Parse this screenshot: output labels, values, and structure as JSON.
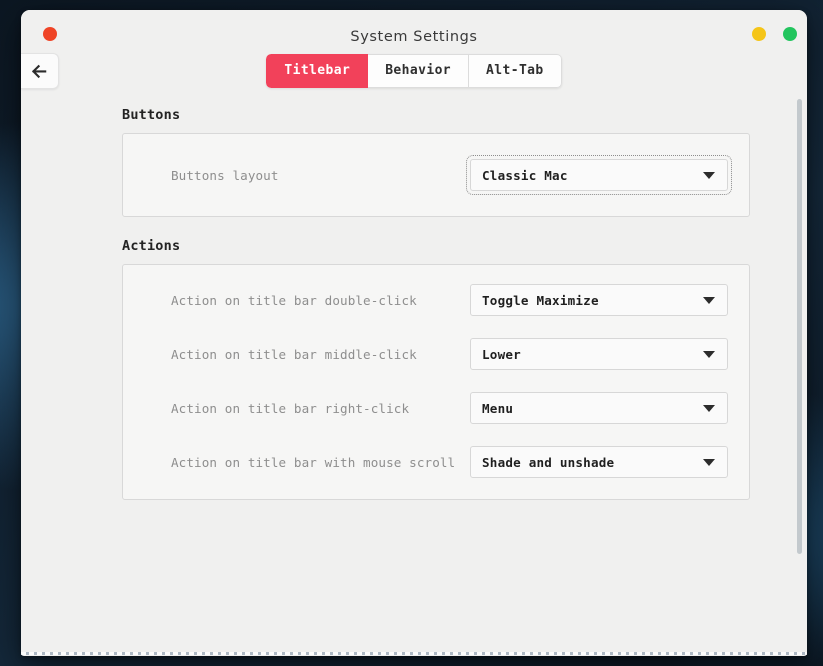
{
  "window": {
    "title": "System Settings",
    "controls": {
      "close": {
        "name": "close-window-button",
        "color": "#ef4426"
      },
      "minimize": {
        "name": "minimize-window-button",
        "color": "#f5c518"
      },
      "maximize": {
        "name": "maximize-window-button",
        "color": "#22c55e"
      }
    },
    "back_button_icon": "arrow-left-icon"
  },
  "accent_color": "#f2415a",
  "tabs": [
    {
      "label": "Titlebar",
      "active": true
    },
    {
      "label": "Behavior",
      "active": false
    },
    {
      "label": "Alt-Tab",
      "active": false
    }
  ],
  "sections": [
    {
      "heading": "Buttons",
      "rows": [
        {
          "label": "Buttons layout",
          "value": "Classic Mac",
          "focused": true
        }
      ]
    },
    {
      "heading": "Actions",
      "rows": [
        {
          "label": "Action on title bar double-click",
          "value": "Toggle Maximize",
          "focused": false
        },
        {
          "label": "Action on title bar middle-click",
          "value": "Lower",
          "focused": false
        },
        {
          "label": "Action on title bar right-click",
          "value": "Menu",
          "focused": false
        },
        {
          "label": "Action on title bar with mouse scroll",
          "value": "Shade and unshade",
          "focused": false
        }
      ]
    }
  ],
  "scrollbar": {
    "name": "vertical-scrollbar"
  }
}
